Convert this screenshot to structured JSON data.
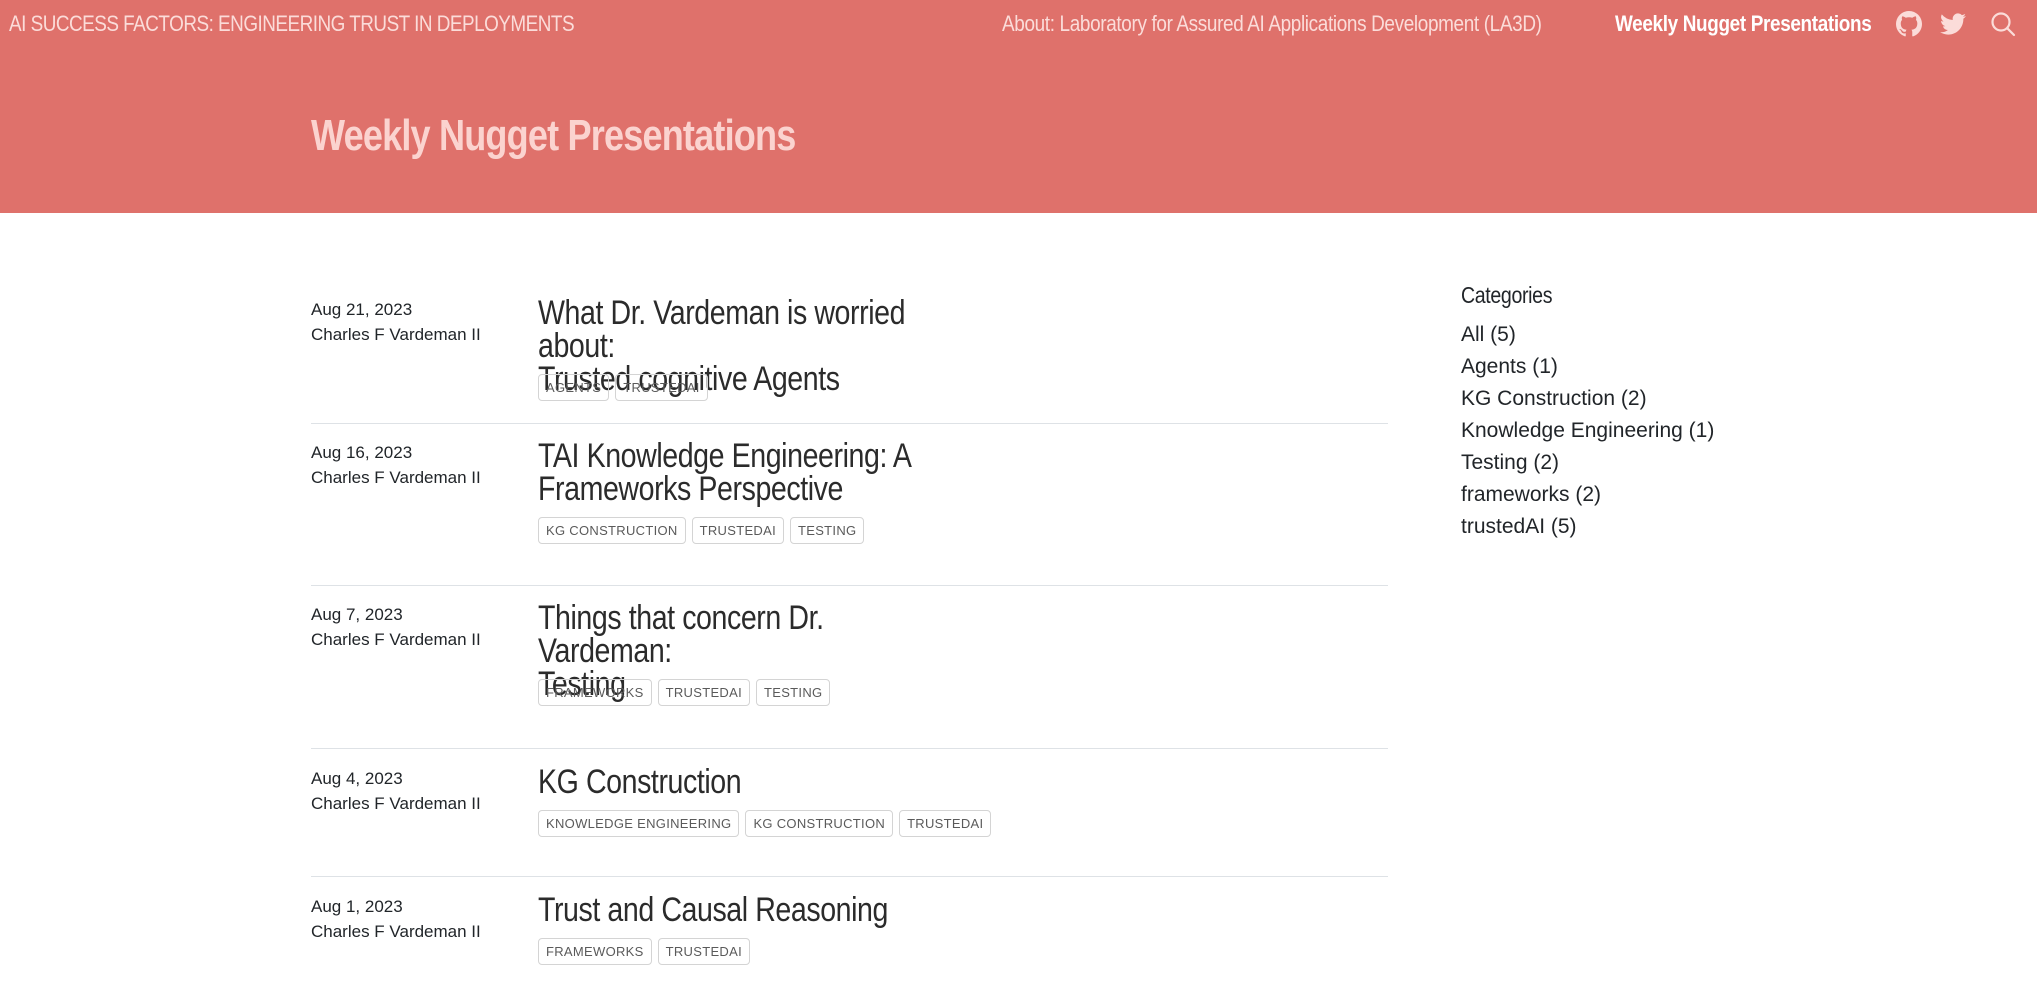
{
  "navbar": {
    "brand": "AI SUCCESS FACTORS: ENGINEERING TRUST IN DEPLOYMENTS",
    "links": [
      {
        "label": "About: Laboratory for Assured AI Applications Development (LA3D)"
      },
      {
        "label": "Weekly Nugget Presentations"
      }
    ],
    "icons": [
      "github-icon",
      "twitter-icon",
      "search-icon"
    ]
  },
  "banner": {
    "title": "Weekly Nugget Presentations"
  },
  "posts": [
    {
      "date": "Aug 21, 2023",
      "author": "Charles F Vardeman II",
      "title_line1": "What Dr. Vardeman is worried about:",
      "title_line2": "Trusted cognitive Agents",
      "tags": [
        "AGENTS",
        "TRUSTEDAI"
      ]
    },
    {
      "date": "Aug 16, 2023",
      "author": "Charles F Vardeman II",
      "title_line1": "TAI Knowledge Engineering: A",
      "title_line2": "Frameworks Perspective",
      "tags": [
        "KG CONSTRUCTION",
        "TRUSTEDAI",
        "TESTING"
      ]
    },
    {
      "date": "Aug 7, 2023",
      "author": "Charles F Vardeman II",
      "title_line1": "Things that concern Dr. Vardeman:",
      "title_line2": "Testing",
      "tags": [
        "FRAMEWORKS",
        "TRUSTEDAI",
        "TESTING"
      ]
    },
    {
      "date": "Aug 4, 2023",
      "author": "Charles F Vardeman II",
      "title_line1": "KG Construction",
      "title_line2": "",
      "tags": [
        "KNOWLEDGE ENGINEERING",
        "KG CONSTRUCTION",
        "TRUSTEDAI"
      ]
    },
    {
      "date": "Aug 1, 2023",
      "author": "Charles F Vardeman II",
      "title_line1": "Trust and Causal Reasoning",
      "title_line2": "",
      "tags": [
        "FRAMEWORKS",
        "TRUSTEDAI"
      ]
    }
  ],
  "sidebar": {
    "heading": "Categories",
    "categories": [
      "All (5)",
      "Agents (1)",
      "KG Construction (2)",
      "Knowledge Engineering (1)",
      "Testing (2)",
      "frameworks (2)",
      "trustedAI (5)"
    ]
  },
  "colors": {
    "header_bg": "#df716b",
    "brand_text": "#fbdcd9",
    "active_link": "#ffffff",
    "banner_title": "#fbd3cf",
    "divider": "#dee2e6"
  }
}
